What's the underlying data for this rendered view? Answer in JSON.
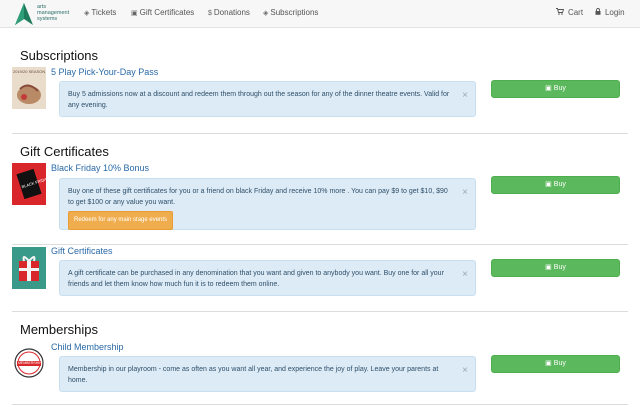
{
  "brand": {
    "name": "arts\nmanagement\nsystems",
    "accent": "#1f7a5c"
  },
  "nav": {
    "tickets": "Tickets",
    "gift_certificates": "Gift Certificates",
    "donations": "Donations",
    "subscriptions": "Subscriptions",
    "cart": "Cart",
    "login": "Login"
  },
  "icons": {
    "ticket": "◈",
    "gift": "▣",
    "dollar": "$",
    "cart": "🛒",
    "lock": "🔒",
    "close": "×"
  },
  "sections": {
    "subscriptions": "Subscriptions",
    "gift_certificates": "Gift Certificates",
    "memberships": "Memberships"
  },
  "items": [
    {
      "title": "5 Play Pick-Your-Day Pass",
      "description": "Buy 5 admissions now at a discount and redeem them through out the season for any of the dinner theatre events. Valid for any evening.",
      "buy": "Buy",
      "thumb_label": "2019/20 SEASON"
    },
    {
      "title": "Black Friday 10% Bonus",
      "description": "Buy one of these gift certificates for you or a friend on black Friday and receive 10% more . You can pay $9 to get $10, $90 to get $100 or any value you want.",
      "promo": "Redeem for any main stage events",
      "buy": "Buy",
      "thumb_label": "BLACK FRIDAY"
    },
    {
      "title": "Gift Certificates",
      "description": "A gift certificate can be purchased in any denomination that you want and given to anybody you want. Buy one for all your friends and let them know how much fun it is to redeem them online.",
      "buy": "Buy"
    },
    {
      "title": "Child Membership",
      "description": "Membership in our playroom - come as often as you want all year, and experience the joy of play. Leave your parents at home.",
      "buy": "Buy",
      "thumb_label": "MEMBERSHIP"
    }
  ],
  "colors": {
    "buy_green": "#5cb85c",
    "info_blue": "#dcebf6",
    "promo_orange": "#f0ad4e",
    "link_blue": "#2a6aa8"
  }
}
